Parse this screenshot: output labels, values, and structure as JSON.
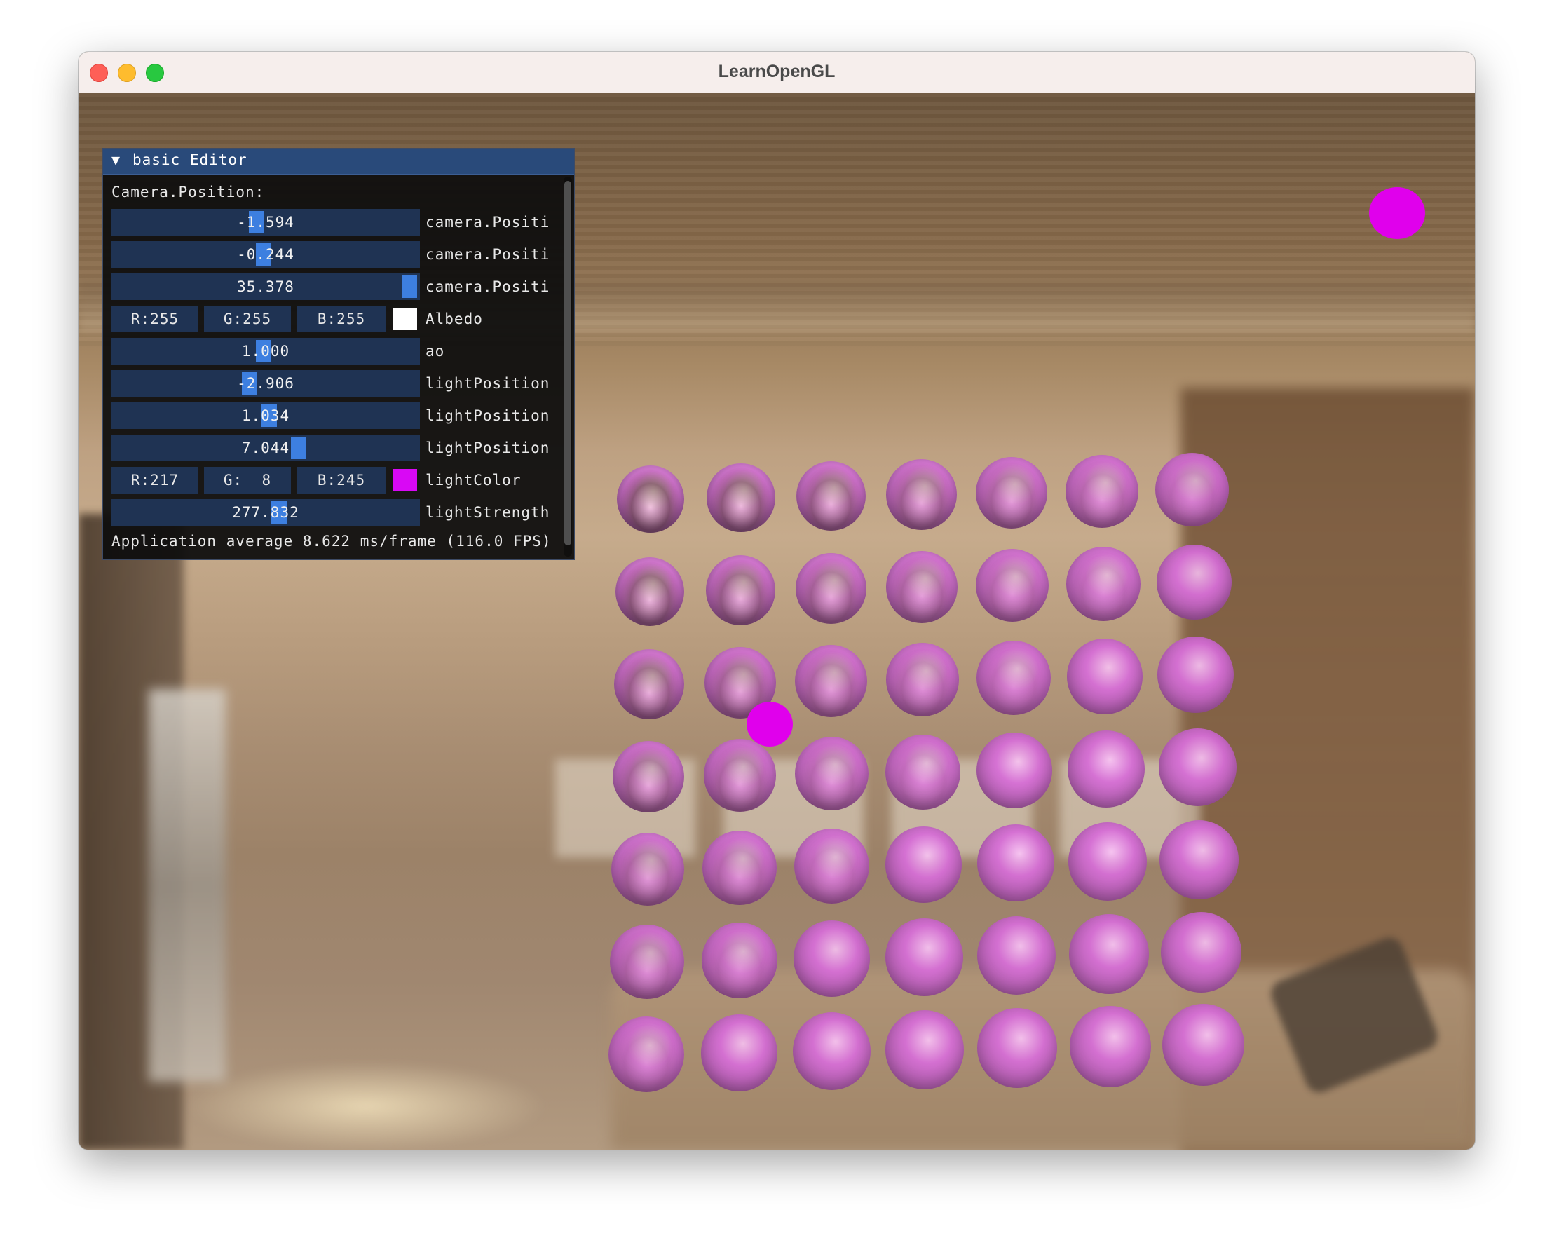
{
  "window": {
    "title": "LearnOpenGL"
  },
  "editor": {
    "title": "basic_Editor",
    "section_label": "Camera.Position:",
    "rows": [
      {
        "type": "drag",
        "value": "-1.594",
        "label": "camera.Positi"
      },
      {
        "type": "drag",
        "value": "-0.244",
        "label": "camera.Positi"
      },
      {
        "type": "drag",
        "value": "35.378",
        "label": "camera.Positi"
      },
      {
        "type": "color",
        "r": "R:255",
        "g": "G:255",
        "b": "B:255",
        "label": "Albedo",
        "swatch": "#ffffff"
      },
      {
        "type": "drag",
        "value": "1.000",
        "label": "ao"
      },
      {
        "type": "drag",
        "value": "-2.906",
        "label": "lightPosition"
      },
      {
        "type": "drag",
        "value": "1.034",
        "label": "lightPosition"
      },
      {
        "type": "drag",
        "value": "7.044",
        "label": "lightPosition"
      },
      {
        "type": "color",
        "r": "R:217",
        "g": "G:  8",
        "b": "B:245",
        "label": "lightColor",
        "swatch": "#d908f5"
      },
      {
        "type": "drag",
        "value": "277.832",
        "label": "lightStrength"
      }
    ],
    "footer": "Application average 8.622 ms/frame (116.0 FPS)"
  },
  "scene": {
    "sphere_grid": {
      "rows": 7,
      "cols": 7
    },
    "light_color": "#e000ec",
    "albedo": "#ffffff"
  }
}
